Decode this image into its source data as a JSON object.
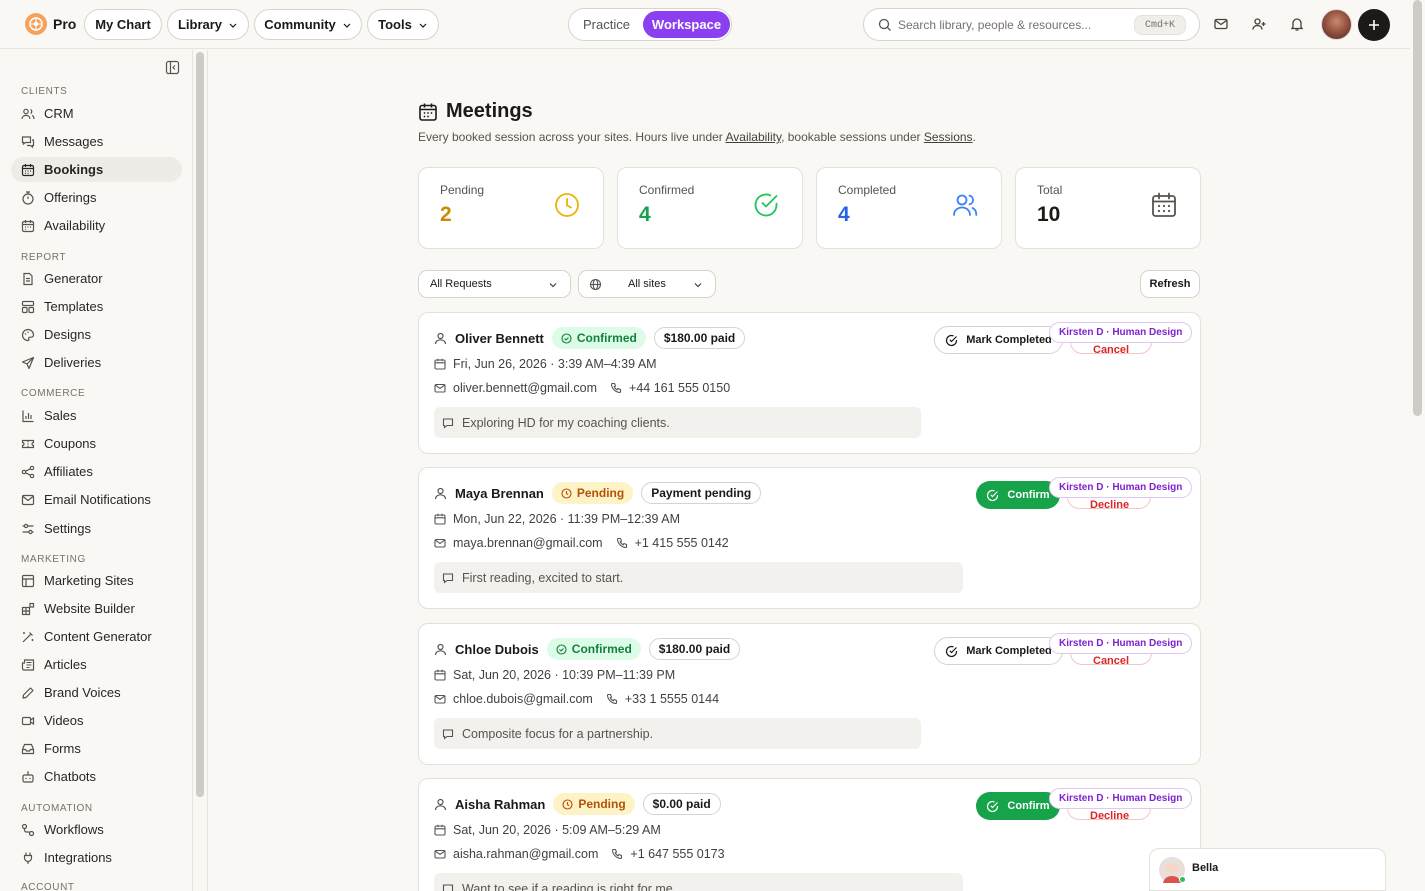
{
  "topbar": {
    "brand": "Pro",
    "nav": [
      {
        "label": "My Chart"
      },
      {
        "label": "Library"
      },
      {
        "label": "Community"
      },
      {
        "label": "Tools"
      }
    ],
    "mode": {
      "inactive": "Practice",
      "active": "Workspace",
      "accent": "#8b3ff0"
    },
    "search": {
      "placeholder": "Search library, people & resources...",
      "shortcut": "Cmd+K"
    }
  },
  "sidebar": {
    "sections": [
      {
        "title": "CLIENTS",
        "items": [
          {
            "label": "CRM",
            "icon": "users-icon"
          },
          {
            "label": "Messages",
            "icon": "messages-icon"
          },
          {
            "label": "Bookings",
            "icon": "calendar-icon",
            "active": true
          },
          {
            "label": "Offerings",
            "icon": "offerings-icon"
          },
          {
            "label": "Availability",
            "icon": "calendar-icon"
          }
        ]
      },
      {
        "title": "REPORT",
        "items": [
          {
            "label": "Generator",
            "icon": "file-icon"
          },
          {
            "label": "Templates",
            "icon": "templates-icon"
          },
          {
            "label": "Designs",
            "icon": "palette-icon"
          },
          {
            "label": "Deliveries",
            "icon": "send-icon"
          }
        ]
      },
      {
        "title": "COMMERCE",
        "items": [
          {
            "label": "Sales",
            "icon": "bar-chart-icon"
          },
          {
            "label": "Coupons",
            "icon": "ticket-icon"
          },
          {
            "label": "Affiliates",
            "icon": "share-icon"
          },
          {
            "label": "Email Notifications",
            "icon": "mail-icon"
          },
          {
            "label": "Settings",
            "icon": "sliders-icon"
          }
        ]
      },
      {
        "title": "MARKETING",
        "items": [
          {
            "label": "Marketing Sites",
            "icon": "layout-icon"
          },
          {
            "label": "Website Builder",
            "icon": "blocks-icon"
          },
          {
            "label": "Content Generator",
            "icon": "wand-icon"
          },
          {
            "label": "Articles",
            "icon": "newspaper-icon"
          },
          {
            "label": "Brand Voices",
            "icon": "pen-icon"
          },
          {
            "label": "Videos",
            "icon": "video-icon"
          },
          {
            "label": "Forms",
            "icon": "inbox-icon"
          },
          {
            "label": "Chatbots",
            "icon": "bot-icon"
          }
        ]
      },
      {
        "title": "AUTOMATION",
        "items": [
          {
            "label": "Workflows",
            "icon": "workflow-icon"
          },
          {
            "label": "Integrations",
            "icon": "plug-icon"
          }
        ]
      },
      {
        "title": "ACCOUNT",
        "items": []
      }
    ]
  },
  "page": {
    "title": "Meetings",
    "subtitle_pre": "Every booked session across your sites. Hours live under ",
    "subtitle_link1": "Availability",
    "subtitle_mid": ", bookable sessions under ",
    "subtitle_link2": "Sessions",
    "subtitle_post": "."
  },
  "stats": [
    {
      "label": "Pending",
      "value": "2",
      "color": "#ca8a04",
      "icon": "clock-icon"
    },
    {
      "label": "Confirmed",
      "value": "4",
      "color": "#16a34a",
      "icon": "check-circle-icon"
    },
    {
      "label": "Completed",
      "value": "4",
      "color": "#2563eb",
      "icon": "users-icon"
    },
    {
      "label": "Total",
      "value": "10",
      "color": "#1c1917",
      "icon": "calendar-icon"
    }
  ],
  "filters": {
    "requests": "All Requests",
    "sites": "All sites",
    "refresh": "Refresh"
  },
  "bookings": [
    {
      "name": "Oliver Bennett",
      "status": "Confirmed",
      "payment": "$180.00 paid",
      "datetime": "Fri, Jun 26, 2026 · 3:39 AM–4:39 AM",
      "email": "oliver.bennett@gmail.com",
      "phone": "+44 161 555 0150",
      "note": "Exploring HD for my coaching clients.",
      "action": "Mark Completed",
      "secondary": "Cancel",
      "site": "Kirsten D · Human Design"
    },
    {
      "name": "Maya Brennan",
      "status": "Pending",
      "payment": "Payment pending",
      "datetime": "Mon, Jun 22, 2026 · 11:39 PM–12:39 AM",
      "email": "maya.brennan@gmail.com",
      "phone": "+1 415 555 0142",
      "note": "First reading, excited to start.",
      "action": "Confirm",
      "secondary": "Decline",
      "site": "Kirsten D · Human Design"
    },
    {
      "name": "Chloe Dubois",
      "status": "Confirmed",
      "payment": "$180.00 paid",
      "datetime": "Sat, Jun 20, 2026 · 10:39 PM–11:39 PM",
      "email": "chloe.dubois@gmail.com",
      "phone": "+33 1 5555 0144",
      "note": "Composite focus for a partnership.",
      "action": "Mark Completed",
      "secondary": "Cancel",
      "site": "Kirsten D · Human Design"
    },
    {
      "name": "Aisha Rahman",
      "status": "Pending",
      "payment": "$0.00 paid",
      "datetime": "Sat, Jun 20, 2026 · 5:09 AM–5:29 AM",
      "email": "aisha.rahman@gmail.com",
      "phone": "+1 647 555 0173",
      "note": "Want to see if a reading is right for me.",
      "action": "Confirm",
      "secondary": "Decline",
      "site": "Kirsten D · Human Design"
    }
  ],
  "chat": {
    "name": "Bella"
  }
}
